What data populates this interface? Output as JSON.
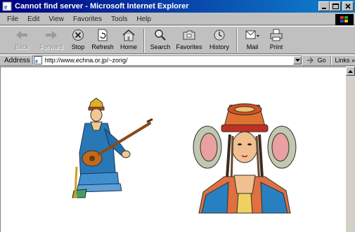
{
  "window": {
    "title": "Cannot find server - Microsoft Internet Explorer"
  },
  "menu": [
    "File",
    "Edit",
    "View",
    "Favorites",
    "Tools",
    "Help"
  ],
  "toolbar": {
    "back": "Back",
    "forward": "Forward",
    "stop": "Stop",
    "refresh": "Refresh",
    "home": "Home",
    "search": "Search",
    "favorites": "Favorites",
    "history": "History",
    "mail": "Mail",
    "print": "Print"
  },
  "address": {
    "label": "Address",
    "url": "http://www.echna.or.jp/~zorig/",
    "go": "Go",
    "links": "Links"
  },
  "content": {
    "images": [
      "mongolian-musician-illustration",
      "mongolian-woman-headdress-illustration"
    ]
  },
  "colors": {
    "titlebar_start": "#000080",
    "titlebar_end": "#1084d0",
    "chrome": "#c0c0c0",
    "page_bg": "#ffffff"
  }
}
